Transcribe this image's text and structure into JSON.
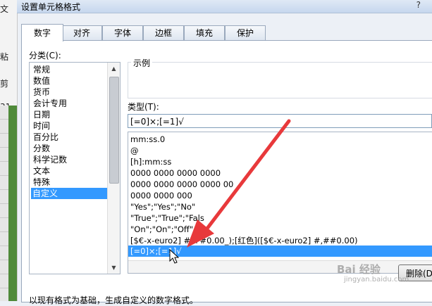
{
  "background": {
    "left_fragments": [
      "文",
      "粘",
      "剪",
      "31"
    ]
  },
  "dialog": {
    "title": "设置单元格格式",
    "help": "?"
  },
  "tabs": [
    {
      "label": "数字",
      "active": true
    },
    {
      "label": "对齐",
      "active": false
    },
    {
      "label": "字体",
      "active": false
    },
    {
      "label": "边框",
      "active": false
    },
    {
      "label": "填充",
      "active": false
    },
    {
      "label": "保护",
      "active": false
    }
  ],
  "category": {
    "label": "分类(C):",
    "items": [
      "常规",
      "数值",
      "货币",
      "会计专用",
      "日期",
      "时间",
      "百分比",
      "分数",
      "科学记数",
      "文本",
      "特殊",
      "自定义"
    ],
    "selected_index": 11
  },
  "sample": {
    "label": "示例"
  },
  "type": {
    "label": "类型(T):",
    "value": "[=0]×;[=1]√"
  },
  "format_list": {
    "items": [
      "mm:ss.0",
      "@",
      "[h]:mm:ss",
      "0000  0000  0000  0000",
      "0000 0000 0000 0000 00",
      "0000 0000 000",
      "\"Yes\";\"Yes\";\"No\"",
      "\"True\";\"True\";\"Fals",
      "\"On\";\"On\";\"Off\"",
      "[$€-x-euro2] #,##0.00_);[红色]([$€-x-euro2] #,##0.00)",
      "[=0]×;[=1]√"
    ],
    "selected_index": 10
  },
  "buttons": {
    "delete": "删除(D)"
  },
  "footer_text": "以现有格式为基础，生成自定义的数字格式。",
  "watermark": {
    "main": "Bai 经验",
    "sub": "jingyan.baidu.com"
  },
  "colors": {
    "selection": "#3399ff",
    "arrow": "#e8393b"
  }
}
